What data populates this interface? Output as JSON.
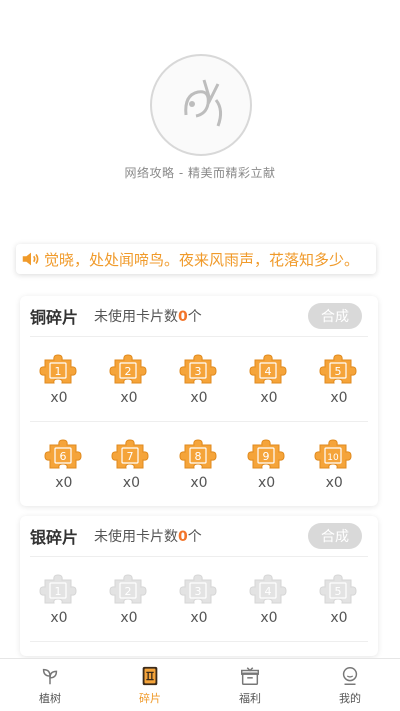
{
  "logo": {
    "caption": "网络攻略 - 精美而精彩立献"
  },
  "marquee": {
    "text": "觉晓，处处闻啼鸟。夜来风雨声，花落知多少。"
  },
  "copper": {
    "title": "铜碎片",
    "unused_prefix": "未使用卡片数",
    "unused_count": "0",
    "unused_suffix": "个",
    "merge_label": "合成",
    "pieces": [
      {
        "n": "1",
        "count": "x0"
      },
      {
        "n": "2",
        "count": "x0"
      },
      {
        "n": "3",
        "count": "x0"
      },
      {
        "n": "4",
        "count": "x0"
      },
      {
        "n": "5",
        "count": "x0"
      },
      {
        "n": "6",
        "count": "x0"
      },
      {
        "n": "7",
        "count": "x0"
      },
      {
        "n": "8",
        "count": "x0"
      },
      {
        "n": "9",
        "count": "x0"
      },
      {
        "n": "10",
        "count": "x0"
      }
    ]
  },
  "silver": {
    "title": "银碎片",
    "unused_prefix": "未使用卡片数",
    "unused_count": "0",
    "unused_suffix": "个",
    "merge_label": "合成",
    "pieces": [
      {
        "n": "1",
        "count": "x0"
      },
      {
        "n": "2",
        "count": "x0"
      },
      {
        "n": "3",
        "count": "x0"
      },
      {
        "n": "4",
        "count": "x0"
      },
      {
        "n": "5",
        "count": "x0"
      }
    ]
  },
  "colors": {
    "copper": "#f5a43a",
    "silver": "#e3e3e3",
    "accent": "#f09a2a"
  },
  "tabs": [
    {
      "label": "植树",
      "icon": "sprout-icon"
    },
    {
      "label": "碎片",
      "icon": "card-icon"
    },
    {
      "label": "福利",
      "icon": "gift-icon"
    },
    {
      "label": "我的",
      "icon": "profile-icon"
    }
  ]
}
